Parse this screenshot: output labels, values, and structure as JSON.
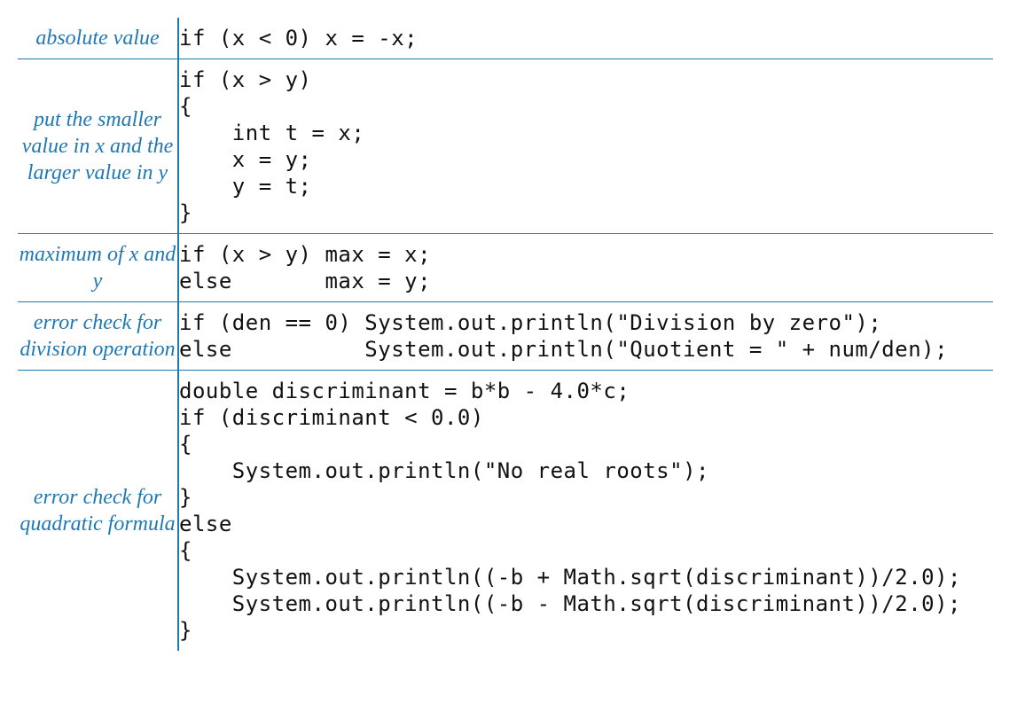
{
  "rows": [
    {
      "label": "absolute value",
      "code": "if (x < 0) x = -x;"
    },
    {
      "label": "put the smaller\nvalue in x\nand the larger\nvalue in y",
      "code": "if (x > y)\n{\n    int t = x;\n    x = y;\n    y = t;\n}"
    },
    {
      "label": "maximum of\nx and y",
      "code": "if (x > y) max = x;\nelse       max = y;"
    },
    {
      "label": "error check\nfor division\noperation",
      "code": "if (den == 0) System.out.println(\"Division by zero\");\nelse          System.out.println(\"Quotient = \" + num/den);"
    },
    {
      "label": "error check\nfor quadratic\nformula",
      "code": "double discriminant = b*b - 4.0*c;\nif (discriminant < 0.0)\n{\n    System.out.println(\"No real roots\");\n}\nelse\n{\n    System.out.println((-b + Math.sqrt(discriminant))/2.0);\n    System.out.println((-b - Math.sqrt(discriminant))/2.0);\n}"
    }
  ]
}
